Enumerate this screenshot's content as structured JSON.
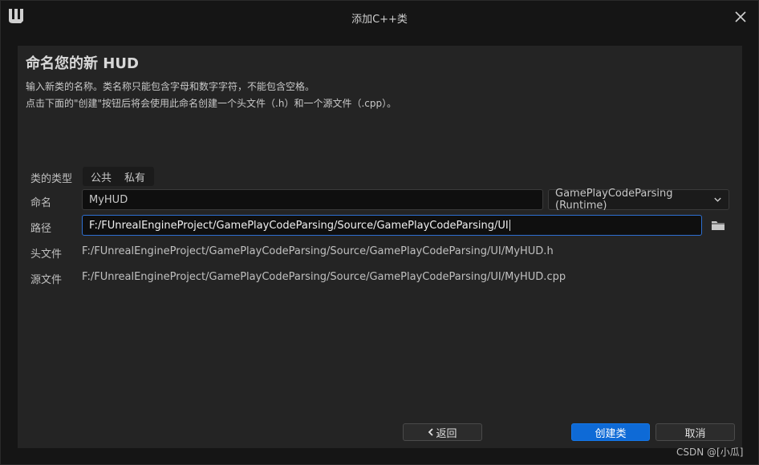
{
  "window": {
    "title": "添加C++类"
  },
  "heading": {
    "prefix": "命名您的新",
    "class_name": "HUD"
  },
  "description": {
    "line1": "输入新类的名称。类名称只能包含字母和数字字符，不能包含空格。",
    "line2": "点击下面的\"创建\"按钮后将会使用此命名创建一个头文件（.h）和一个源文件（.cpp）。"
  },
  "form": {
    "class_type_label": "类的类型",
    "class_type_options": [
      "公共",
      "私有"
    ],
    "name_label": "命名",
    "name_value": "MyHUD",
    "module_value": "GamePlayCodeParsing (Runtime)",
    "path_label": "路径",
    "path_value": "F:/FUnrealEngineProject/GamePlayCodeParsing/Source/GamePlayCodeParsing/UI",
    "header_label": "头文件",
    "header_value": "F:/FUnrealEngineProject/GamePlayCodeParsing/Source/GamePlayCodeParsing/UI/MyHUD.h",
    "source_label": "源文件",
    "source_value": "F:/FUnrealEngineProject/GamePlayCodeParsing/Source/GamePlayCodeParsing/UI/MyHUD.cpp"
  },
  "buttons": {
    "back": "返回",
    "create": "创建类",
    "cancel": "取消"
  },
  "watermark": "CSDN @[小瓜]",
  "colors": {
    "primary_button": "#0e6ad6",
    "focus_border": "#2e6fd1"
  }
}
